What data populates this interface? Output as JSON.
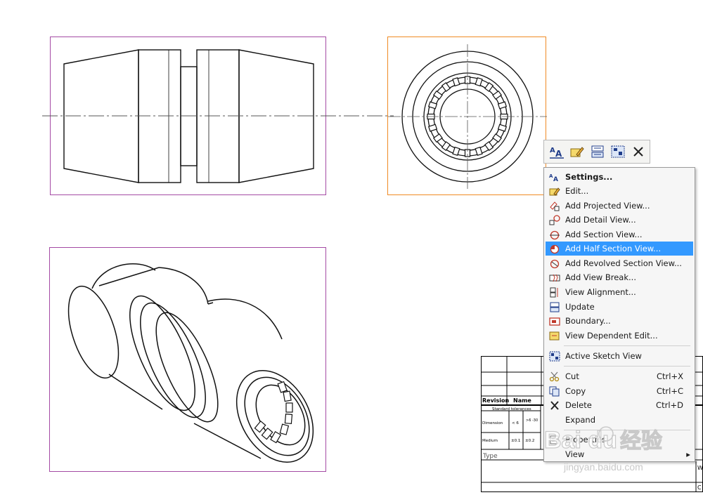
{
  "toolbar": {
    "icons": [
      "text-style-icon",
      "edit-properties-icon",
      "update-view-icon",
      "active-sketch-icon",
      "close-icon"
    ]
  },
  "menu": {
    "items": [
      {
        "label": "Settings...",
        "icon": "text-style-icon"
      },
      {
        "label": "Edit...",
        "icon": "edit-icon"
      },
      {
        "label": "Add Projected View...",
        "icon": "projected-view-icon"
      },
      {
        "label": "Add Detail View...",
        "icon": "detail-view-icon"
      },
      {
        "label": "Add Section View...",
        "icon": "section-view-icon"
      },
      {
        "label": "Add Half Section View...",
        "icon": "half-section-view-icon"
      },
      {
        "label": "Add Revolved Section View...",
        "icon": "revolved-section-icon"
      },
      {
        "label": "Add View Break...",
        "icon": "view-break-icon"
      },
      {
        "label": "View Alignment...",
        "icon": "view-alignment-icon"
      },
      {
        "label": "Update",
        "icon": "update-icon"
      },
      {
        "label": "Boundary...",
        "icon": "boundary-icon"
      },
      {
        "label": "View Dependent Edit...",
        "icon": "dependent-edit-icon"
      },
      {
        "label": "Active Sketch View",
        "icon": "active-sketch-icon"
      },
      {
        "label": "Cut",
        "shortcut": "Ctrl+X",
        "icon": "scissors-icon"
      },
      {
        "label": "Copy",
        "shortcut": "Ctrl+C",
        "icon": "copy-icon"
      },
      {
        "label": "Delete",
        "shortcut": "Ctrl+D",
        "icon": "delete-x-icon"
      },
      {
        "label": "Expand"
      },
      {
        "label": "Properties",
        "icon": "properties-icon"
      },
      {
        "label": "View",
        "icon": "submenu-arrow-icon"
      }
    ]
  },
  "titleblock": {
    "revision": "Revision",
    "name": "Name",
    "standard_tolerances": "Standard tolerances",
    "dimension": "Dimension",
    "medium": "Medium",
    "col1": "< 6",
    "col2": ">6\n-30",
    "medium_1": "±0.1",
    "medium_2": "±0.2",
    "type": "Type",
    "right_w": "W",
    "right_c": "C"
  },
  "watermark": {
    "brand": "Bai du",
    "cn": "经验",
    "url": "jingyan.baidu.com"
  },
  "colors": {
    "view_border": "#9b3a9b",
    "selected_view_border": "#f08a24",
    "menu_highlight": "#3399ff"
  }
}
